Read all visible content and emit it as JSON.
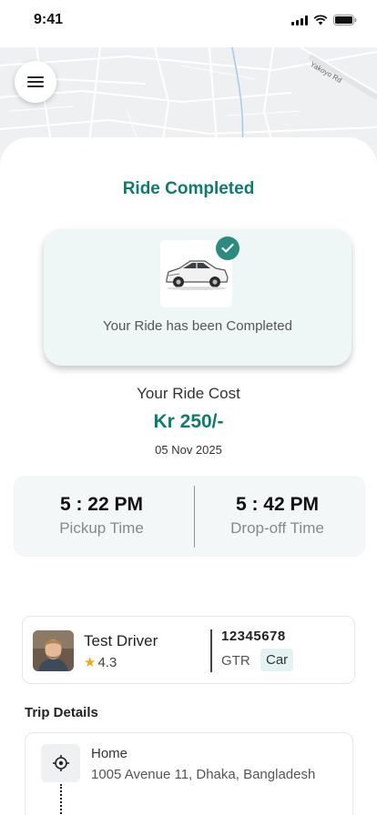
{
  "status_bar": {
    "time": "9:41"
  },
  "map": {
    "street_label": "Yakoyo Rd"
  },
  "title": "Ride Completed",
  "completion_card": {
    "message": "Your Ride has been Completed"
  },
  "cost": {
    "label": "Your Ride Cost",
    "value": "Kr 250/-",
    "date": "05 Nov 2025"
  },
  "times": {
    "pickup": {
      "time": "5 : 22 PM",
      "label": "Pickup Time"
    },
    "dropoff": {
      "time": "5 : 42 PM",
      "label": "Drop-off Time"
    }
  },
  "driver": {
    "name": "Test Driver",
    "rating": "4.3",
    "vehicle_number": "12345678",
    "vehicle_model": "GTR",
    "vehicle_type": "Car"
  },
  "trip": {
    "title": "Trip Details",
    "pickup": {
      "name": "Home",
      "address": "1005 Avenue 11, Dhaka, Bangladesh"
    }
  },
  "colors": {
    "accent": "#0f7b6f",
    "check": "#2d8a7e",
    "star": "#f2a81d"
  },
  "icons": [
    "menu-icon",
    "check-icon",
    "car-icon",
    "star-icon",
    "location-target-icon",
    "signal-icon",
    "wifi-icon",
    "battery-icon"
  ]
}
